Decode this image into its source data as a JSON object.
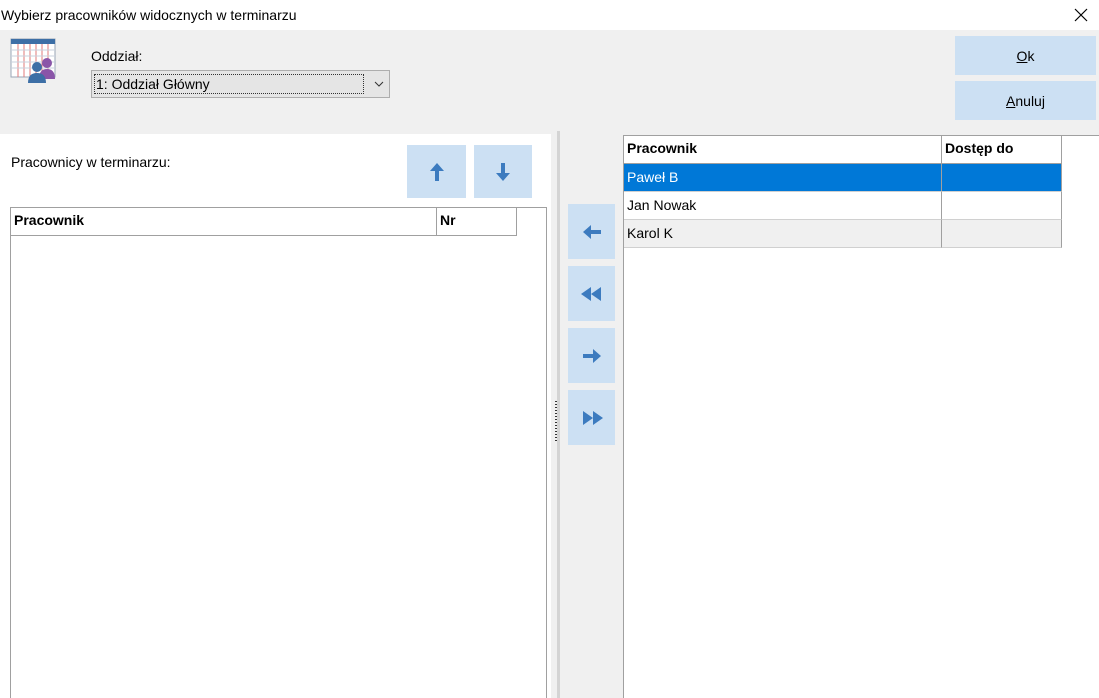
{
  "window": {
    "title": "Wybierz pracowników widocznych w terminarzu"
  },
  "header": {
    "department_label": "Oddział:",
    "department_value": "1: Oddział Główny",
    "ok_label": "Ok",
    "cancel_label": "Anuluj"
  },
  "left": {
    "label": "Pracownicy w terminarzu:",
    "columns": [
      "Pracownik",
      "Nr"
    ],
    "rows": []
  },
  "right": {
    "columns": [
      "Pracownik",
      "Dostęp do"
    ],
    "rows": [
      {
        "name": "Paweł B",
        "access": ""
      },
      {
        "name": "Jan Nowak",
        "access": ""
      },
      {
        "name": "Karol K",
        "access": ""
      }
    ]
  },
  "icons": {
    "close": "close-icon",
    "up": "arrow-up-icon",
    "down": "arrow-down-icon",
    "left": "arrow-left-icon",
    "left_all": "double-arrow-left-icon",
    "right": "arrow-right-icon",
    "right_all": "double-arrow-right-icon"
  },
  "colors": {
    "accent": "#0078d7",
    "button": "#cce0f3",
    "arrow": "#3c7bbf"
  }
}
